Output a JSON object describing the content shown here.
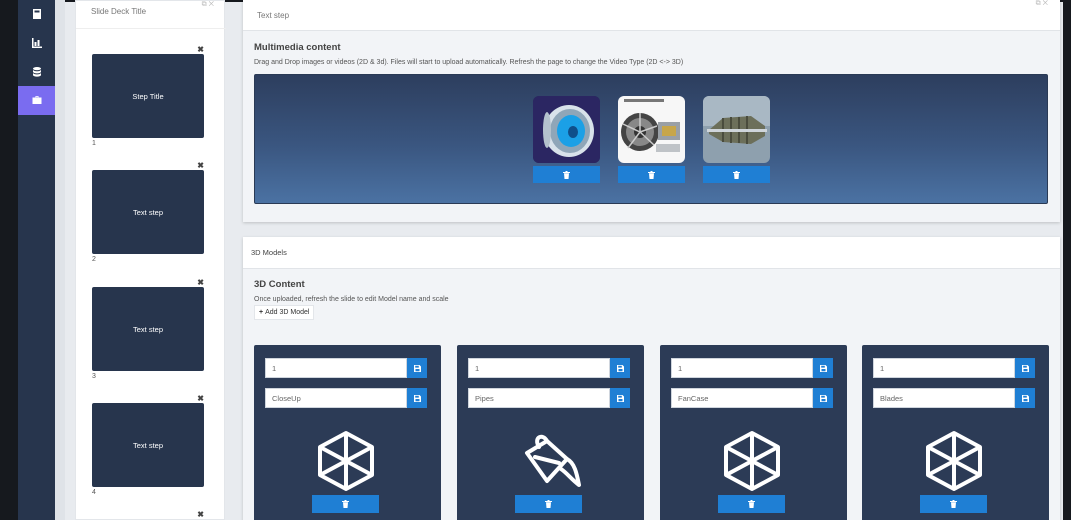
{
  "slide_panel": {
    "title": "Slide Deck Title",
    "slides": [
      {
        "label": "Step Title",
        "number": "1"
      },
      {
        "label": "Text step",
        "number": "2"
      },
      {
        "label": "Text step",
        "number": "3"
      },
      {
        "label": "Text step",
        "number": "4"
      }
    ]
  },
  "step_panel": {
    "header": "Text step",
    "section_title": "Multimedia content",
    "help": "Drag and Drop images or videos (2D & 3d). Files will start to upload automatically. Refresh the page to change the Video Type (2D <-> 3D)",
    "media": [
      {
        "icon": "engine-fan-image"
      },
      {
        "icon": "engine-diagram-image"
      },
      {
        "icon": "turbine-shaft-image"
      }
    ]
  },
  "models_panel": {
    "header": "3D Models",
    "section_title": "3D Content",
    "help": "Once uploaded, refresh the slide to edit Model name and scale",
    "add_button": "Add 3D Model",
    "models": [
      {
        "scale": "1",
        "name": "CloseUp",
        "icon": "cube-icon"
      },
      {
        "scale": "1",
        "name": "Pipes",
        "icon": "paint-bucket-icon"
      },
      {
        "scale": "1",
        "name": "FanCase",
        "icon": "cube-icon"
      },
      {
        "scale": "1",
        "name": "Blades",
        "icon": "cube-icon"
      }
    ]
  },
  "colors": {
    "sidebar": "#27354d",
    "active": "#7a6cf0",
    "button": "#1f7fd4",
    "card": "#2c3b56"
  }
}
